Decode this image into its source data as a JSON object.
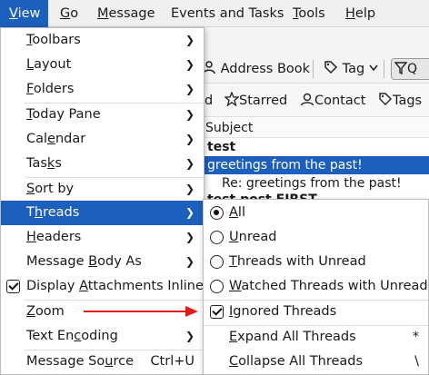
{
  "menubar": {
    "items": [
      {
        "label": "View",
        "ul": "V",
        "rest": "iew"
      },
      {
        "label": "Go",
        "ul": "G",
        "rest": "o"
      },
      {
        "label": "Message",
        "ul": "M",
        "rest": "essage"
      },
      {
        "label": "Events and Tasks",
        "ul": "",
        "rest": "Events and Tasks"
      },
      {
        "label": "Tools",
        "ul": "T",
        "rest": "ools"
      },
      {
        "label": "Help",
        "ul": "H",
        "rest": "elp"
      }
    ]
  },
  "toolbar": {
    "address_book": "Address Book",
    "tag": "Tag",
    "quick_filter": "Q"
  },
  "filterbar": {
    "partial": "d",
    "starred": "Starred",
    "contact": "Contact",
    "tags": "Tags"
  },
  "list": {
    "subject_header": "Subject",
    "rows": [
      {
        "text": "test"
      },
      {
        "text": "greetings from the past!"
      },
      {
        "text": "Re: greetings from the past!"
      },
      {
        "text": "test post FIRST"
      }
    ]
  },
  "view_menu": {
    "items": [
      {
        "pre": "",
        "ul": "T",
        "post": "oolbars"
      },
      {
        "pre": "",
        "ul": "L",
        "post": "ayout"
      },
      {
        "pre": "",
        "ul": "F",
        "post": "olders"
      },
      {
        "pre": "",
        "ul": "T",
        "post": "oday Pane"
      },
      {
        "pre": "Cal",
        "ul": "e",
        "post": "ndar"
      },
      {
        "pre": "Tas",
        "ul": "k",
        "post": "s"
      },
      {
        "pre": "",
        "ul": "S",
        "post": "ort by"
      },
      {
        "pre": "T",
        "ul": "h",
        "post": "reads"
      },
      {
        "pre": "",
        "ul": "H",
        "post": "eaders"
      },
      {
        "pre": "Message ",
        "ul": "B",
        "post": "ody As"
      },
      {
        "pre": "Display ",
        "ul": "A",
        "post": "ttachments Inline"
      },
      {
        "pre": "",
        "ul": "Z",
        "post": "oom"
      },
      {
        "pre": "Text En",
        "ul": "c",
        "post": "oding"
      },
      {
        "pre": "Message So",
        "ul": "u",
        "post": "rce"
      }
    ],
    "source_shortcut": "Ctrl+U"
  },
  "threads_menu": {
    "items": [
      {
        "pre": "",
        "ul": "A",
        "post": "ll"
      },
      {
        "pre": "",
        "ul": "U",
        "post": "nread"
      },
      {
        "pre": "",
        "ul": "T",
        "post": "hreads with Unread"
      },
      {
        "pre": "",
        "ul": "W",
        "post": "atched Threads with Unread"
      },
      {
        "pre": "",
        "ul": "I",
        "post": "gnored Threads"
      },
      {
        "pre": "",
        "ul": "E",
        "post": "xpand All Threads"
      },
      {
        "pre": "",
        "ul": "C",
        "post": "ollapse All Threads"
      }
    ],
    "expand_shortcut": "*",
    "collapse_shortcut": "\\"
  },
  "colors": {
    "highlight": "#1c5fbd",
    "annotation_arrow": "#e21a1a"
  },
  "icons": [
    "person-card-icon",
    "tag-icon",
    "filter-icon",
    "star-icon",
    "contact-icon",
    "tags-icon",
    "chevron-right-icon",
    "checkbox-icon",
    "radio-icon"
  ]
}
